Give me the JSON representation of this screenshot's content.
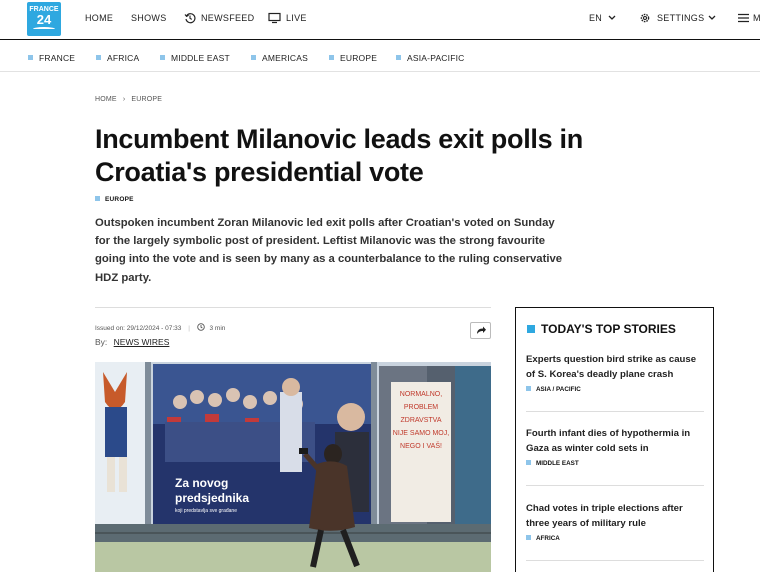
{
  "header": {
    "logo_line1": "FRANCE",
    "logo_line2": "24",
    "nav": [
      "HOME",
      "SHOWS",
      "NEWSFEED",
      "LIVE"
    ],
    "language": "EN",
    "settings_label": "SETTINGS",
    "menu_label": "M",
    "accent": "#2ea8e0"
  },
  "regions": [
    "FRANCE",
    "AFRICA",
    "MIDDLE EAST",
    "AMERICAS",
    "EUROPE",
    "ASIA-PACIFIC"
  ],
  "breadcrumb": {
    "home": "HOME",
    "sep": "›",
    "section": "EUROPE"
  },
  "article": {
    "title": "Incumbent Milanovic leads exit polls in Croatia's presidential vote",
    "tag": "EUROPE",
    "lede": "Outspoken incumbent Zoran Milanovic led exit polls after Croatian's voted on Sunday for the largely symbolic post of president. Leftist Milanovic was the strong favourite going into the vote and is seen by many as a counterbalance to the ruling conservative HDZ party.",
    "issued": "Issued on: 29/12/2024 - 07:33",
    "read_time": "3 min",
    "by_label": "By:",
    "author": "NEWS WIRES",
    "photo": {
      "billboard_left_line1": "Za novog",
      "billboard_left_line2": "predsjednika",
      "billboard_left_line3": "koji predstavlja sve građane",
      "billboard_right": [
        "NORMALNO,",
        "PROBLEM",
        "ZDRAVSTVA",
        "NIJE SAMO MOJ,",
        "NEGO I VAŠ!"
      ]
    }
  },
  "sidebar": {
    "title": "TODAY'S TOP STORIES",
    "stories": [
      {
        "title": "Experts question bird strike as cause of S. Korea's deadly plane crash",
        "tag": "ASIA / PACIFIC"
      },
      {
        "title": "Fourth infant dies of hypothermia in Gaza as winter cold sets in",
        "tag": "MIDDLE EAST"
      },
      {
        "title": "Chad votes in triple elections after three years of military rule",
        "tag": "AFRICA"
      }
    ]
  }
}
